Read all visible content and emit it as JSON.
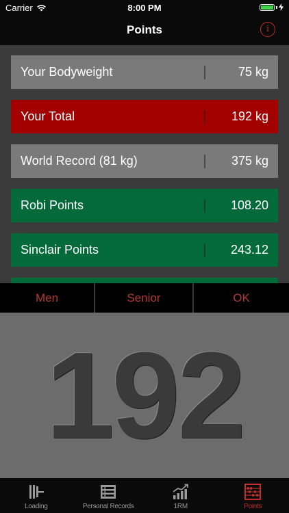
{
  "status": {
    "carrier": "Carrier",
    "time": "8:00 PM"
  },
  "nav": {
    "title": "Points",
    "info_icon": "info-icon"
  },
  "rows": [
    {
      "label": "Your Bodyweight",
      "value": "75 kg",
      "color": "#7a7a7a"
    },
    {
      "label": "Your Total",
      "value": "192 kg",
      "color": "#a30000"
    },
    {
      "label": "World Record (81 kg)",
      "value": "375 kg",
      "color": "#7a7a7a"
    },
    {
      "label": "Robi Points",
      "value": "108.20",
      "color": "#046a3a"
    },
    {
      "label": "Sinclair Points",
      "value": "243.12",
      "color": "#046a3a"
    }
  ],
  "picker": {
    "gender": "Men",
    "category": "Senior",
    "ok": "OK"
  },
  "big_number": "192",
  "tabs": [
    {
      "label": "Loading",
      "icon": "barbell-plates-icon"
    },
    {
      "label": "Personal Records",
      "icon": "records-list-icon"
    },
    {
      "label": "1RM",
      "icon": "growth-chart-icon"
    },
    {
      "label": "Points",
      "icon": "abacus-icon",
      "active": true
    }
  ],
  "colors": {
    "accent": "#c0302a",
    "red_row": "#a30000",
    "green_row": "#046a3a",
    "gray_row": "#7a7a7a"
  }
}
